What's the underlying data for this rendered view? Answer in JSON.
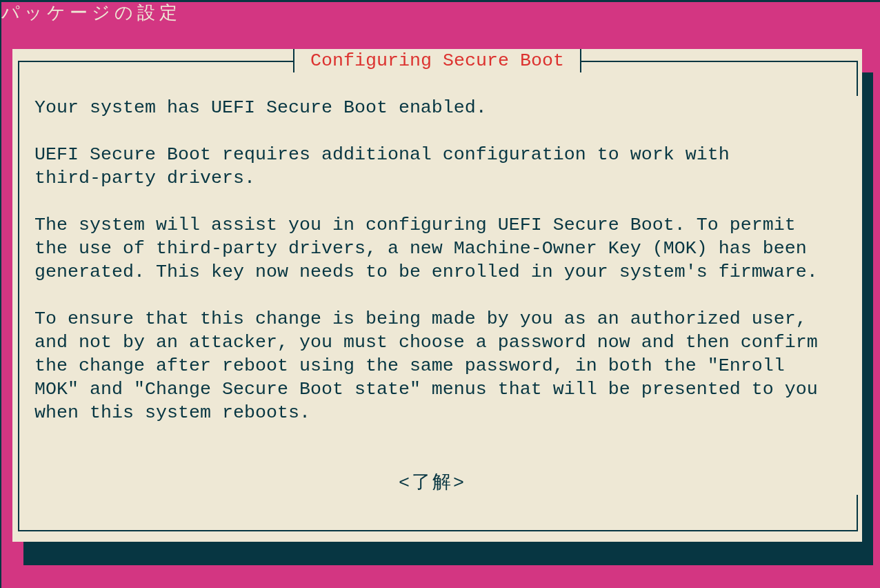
{
  "window": {
    "title": "パッケージの設定"
  },
  "dialog": {
    "title": "Configuring Secure Boot",
    "paragraphs": [
      "Your system has UEFI Secure Boot enabled.",
      "UEFI Secure Boot requires additional configuration to work with\nthird-party drivers.",
      "The system will assist you in configuring UEFI Secure Boot. To permit\nthe use of third-party drivers, a new Machine-Owner Key (MOK) has been\ngenerated. This key now needs to be enrolled in your system's firmware.",
      "To ensure that this change is being made by you as an authorized user,\nand not by an attacker, you must choose a password now and then confirm\nthe change after reboot using the same password, in both the \"Enroll\nMOK\" and \"Change Secure Boot state\" menus that will be presented to you\nwhen this system reboots."
    ],
    "buttons": [
      {
        "label": "<了解>"
      }
    ]
  }
}
